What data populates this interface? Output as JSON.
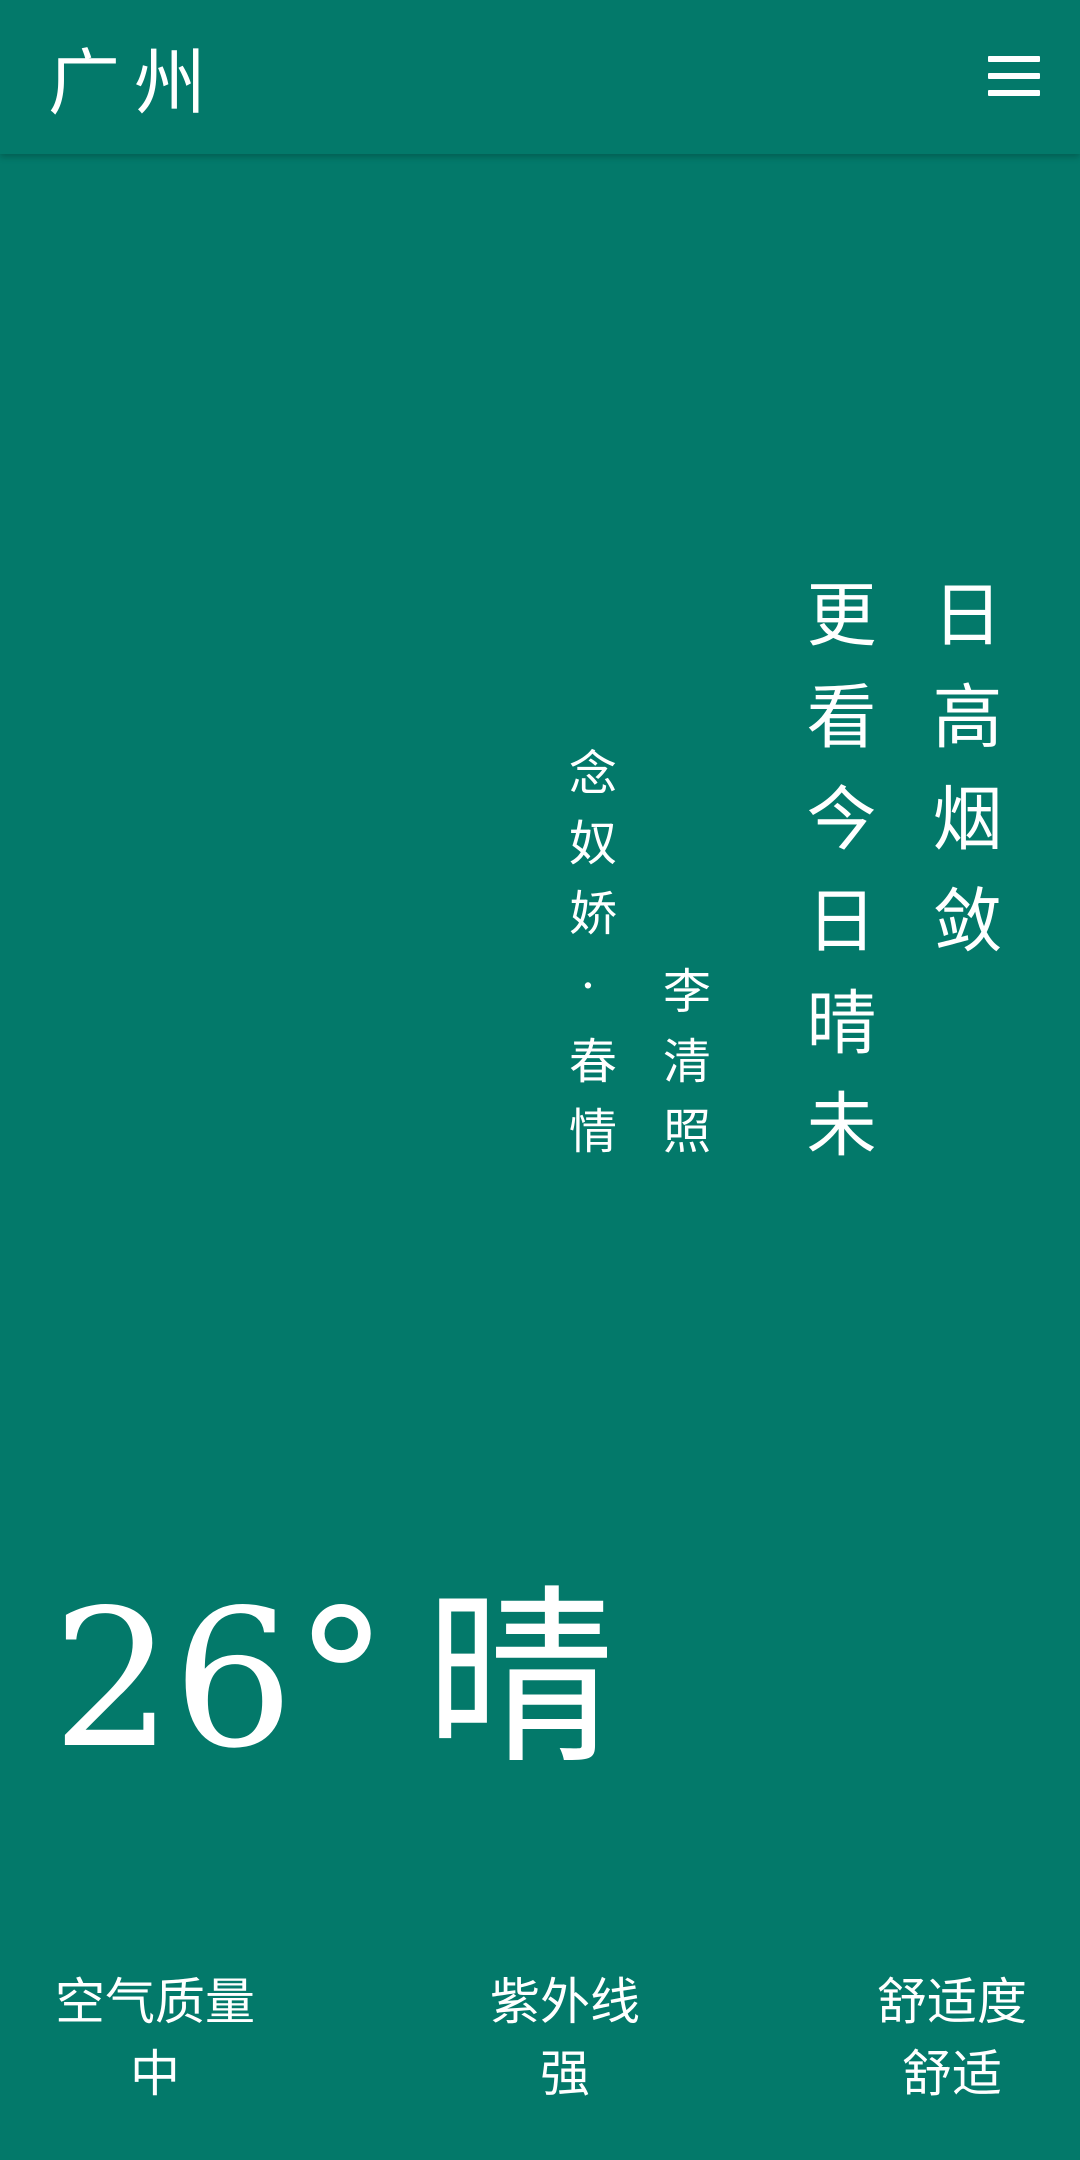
{
  "header": {
    "city": "广州",
    "menu_icon": "hamburger-menu-icon"
  },
  "poem": {
    "line1": "日高烟敛",
    "line2": "更看今日晴未",
    "author": "李清照",
    "title": "念奴娇·春情"
  },
  "weather": {
    "temperature": "26°",
    "condition": "晴"
  },
  "stats": [
    {
      "label": "空气质量",
      "value": "中"
    },
    {
      "label": "紫外线",
      "value": "强"
    },
    {
      "label": "舒适度",
      "value": "舒适"
    }
  ],
  "colors": {
    "background": "#03796A",
    "text": "#FFFFFF"
  }
}
